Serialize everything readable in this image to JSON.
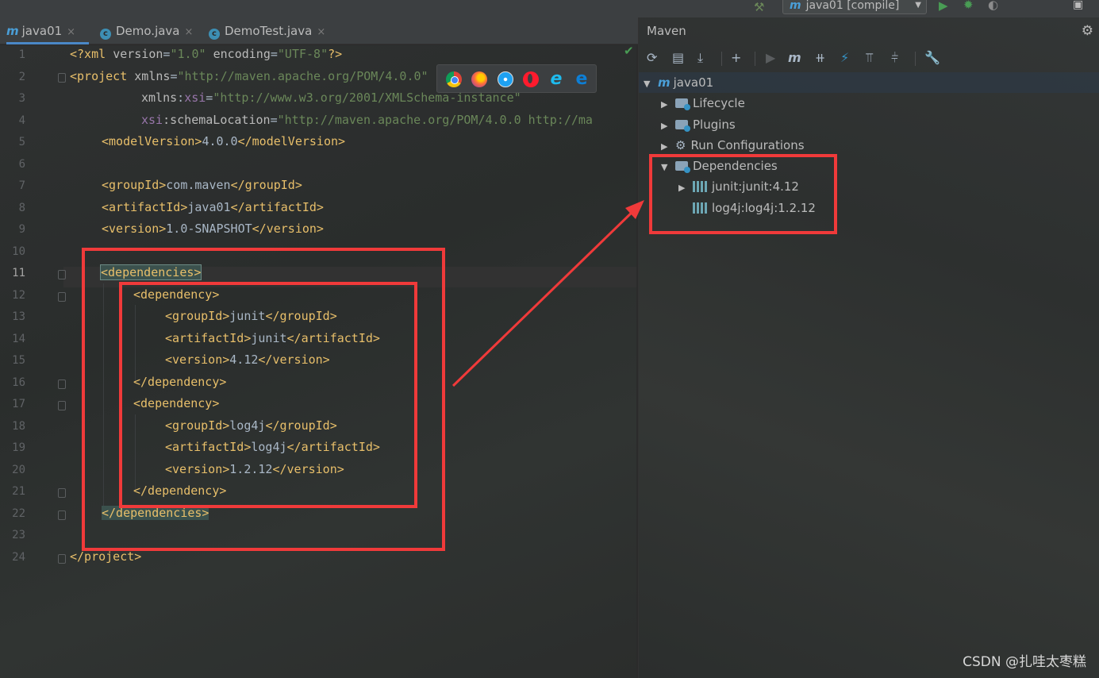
{
  "run_bar": {
    "config_icon": "m",
    "config_label": "java01 [compile]",
    "arrow": "▼"
  },
  "tabs": [
    {
      "icon": "m",
      "label": "java01",
      "close": "×"
    },
    {
      "icon": "c",
      "label": "Demo.java",
      "close": "×"
    },
    {
      "icon": "c",
      "label": "DemoTest.java",
      "close": "×"
    }
  ],
  "editor": {
    "line_numbers": [
      "1",
      "2",
      "3",
      "4",
      "5",
      "6",
      "7",
      "8",
      "9",
      "10",
      "11",
      "12",
      "13",
      "14",
      "15",
      "16",
      "17",
      "18",
      "19",
      "20",
      "21",
      "22",
      "23",
      "24"
    ],
    "lines": {
      "l1": {
        "a": "<?xml ",
        "b": "version",
        "c": "=",
        "d": "\"1.0\"",
        "e": " encoding",
        "f": "=",
        "g": "\"UTF-8\"",
        "h": "?>"
      },
      "l2": {
        "a": "<project ",
        "b": "xmlns",
        "c": "=",
        "d": "\"http://maven.apache.org/POM/4.0.0\""
      },
      "l3": {
        "a": "xmlns",
        "b": ":",
        "c": "xsi",
        "d": "=",
        "e": "\"http://www.w3.org/2001/XMLSchema-instance\""
      },
      "l4": {
        "a": "xsi",
        "b": ":schemaLocation",
        "c": "=",
        "d": "\"http://maven.apache.org/POM/4.0.0 http://ma"
      },
      "l5": {
        "open": "<modelVersion>",
        "text": "4.0.0",
        "close": "</modelVersion>"
      },
      "l7": {
        "open": "<groupId>",
        "text": "com.maven",
        "close": "</groupId>"
      },
      "l8": {
        "open": "<artifactId>",
        "text": "java01",
        "close": "</artifactId>"
      },
      "l9": {
        "open": "<version>",
        "text": "1.0-SNAPSHOT",
        "close": "</version>"
      },
      "l11": {
        "open": "<dependencies>"
      },
      "l12": {
        "open": "<dependency>"
      },
      "l13": {
        "open": "<groupId>",
        "text": "junit",
        "close": "</groupId>"
      },
      "l14": {
        "open": "<artifactId>",
        "text": "junit",
        "close": "</artifactId>"
      },
      "l15": {
        "open": "<version>",
        "text": "4.12",
        "close": "</version>"
      },
      "l16": {
        "close": "</dependency>"
      },
      "l17": {
        "open": "<dependency>"
      },
      "l18": {
        "open": "<groupId>",
        "text": "log4j",
        "close": "</groupId>"
      },
      "l19": {
        "open": "<artifactId>",
        "text": "log4j",
        "close": "</artifactId>"
      },
      "l20": {
        "open": "<version>",
        "text": "1.2.12",
        "close": "</version>"
      },
      "l21": {
        "close": "</dependency>"
      },
      "l22": {
        "close": "</dependencies>"
      },
      "l24": {
        "close": "</project>"
      }
    },
    "browser_icons": [
      "chrome-icon",
      "firefox-icon",
      "safari-icon",
      "opera-icon",
      "ie-icon",
      "edge-icon"
    ]
  },
  "maven": {
    "title": "Maven",
    "toolbar_icons": [
      "reload-icon",
      "add-project-icon",
      "download-icon",
      "plus-icon",
      "run-icon",
      "m-icon",
      "skip-tests-icon",
      "lightning-icon",
      "collapse-icon",
      "expand-icon",
      "wrench-icon"
    ],
    "tree": {
      "root": "java01",
      "lifecycle": "Lifecycle",
      "plugins": "Plugins",
      "run_configurations": "Run Configurations",
      "dependencies": "Dependencies",
      "dep1": "junit:junit:4.12",
      "dep2": "log4j:log4j:1.2.12"
    }
  },
  "colors": {
    "annotation_red": "#f03a3a",
    "xml_tag": "#e8bf6a",
    "xml_string": "#6a8759",
    "tab_underline": "#4a88c7"
  },
  "watermark": "CSDN @扎哇太枣糕"
}
